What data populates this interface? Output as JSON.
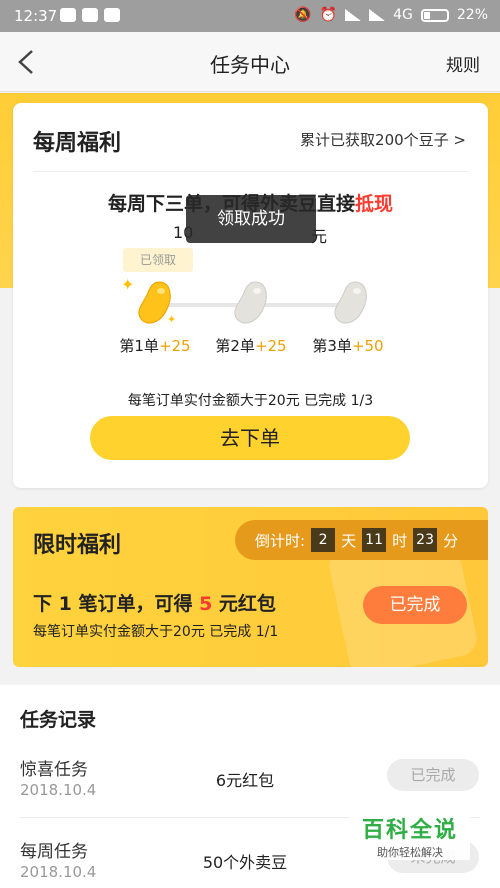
{
  "statusbar": {
    "time": "12:37",
    "network": "4G",
    "battery": "22%"
  },
  "nav": {
    "title": "任务中心",
    "rules": "规则"
  },
  "weekly": {
    "title": "每周福利",
    "link": "累计已获取200个豆子 >",
    "headline_pre": "每周下三单，可得外卖豆直接",
    "headline_red": "抵现",
    "sub_pre": "10",
    "sub_post": "元",
    "claimed_tag": "已领取",
    "steps": [
      {
        "label": "第1单",
        "bonus": "+25"
      },
      {
        "label": "第2单",
        "bonus": "+25"
      },
      {
        "label": "第3单",
        "bonus": "+50"
      }
    ],
    "progress_text": "每笔订单实付金额大于20元 已完成 1/3",
    "button": "去下单"
  },
  "toast": "领取成功",
  "limited": {
    "title": "限时福利",
    "countdown_label": "倒计时:",
    "days": "2",
    "days_unit": "天",
    "hours": "11",
    "hours_unit": "时",
    "minutes": "23",
    "minutes_unit": "分",
    "big_pre": "下 1 笔订单，可得 ",
    "big_num": "5",
    "big_post": " 元红包",
    "small": "每笔订单实付金额大于20元 已完成 1/1",
    "button": "已完成"
  },
  "records": {
    "heading": "任务记录",
    "items": [
      {
        "name": "惊喜任务",
        "date": "2018.10.4",
        "reward": "6元红包",
        "status": "已完成"
      },
      {
        "name": "每周任务",
        "date": "2018.10.4",
        "reward": "50个外卖豆",
        "status": "未完成"
      }
    ]
  },
  "watermark": {
    "line1": "百科全说",
    "line2": "助你轻松解决"
  },
  "colors": {
    "accent": "#ffd22e",
    "red": "#ff3b30",
    "orange_button": "#ff7d3c",
    "bean_gold": "#ffc21a"
  }
}
